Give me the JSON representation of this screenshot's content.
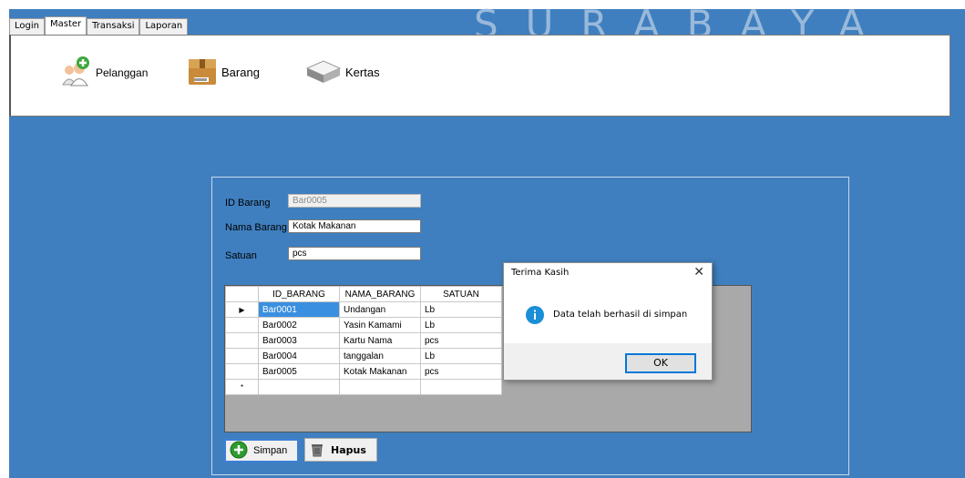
{
  "watermark": "SURABAYA",
  "tabs": [
    {
      "label": "Login"
    },
    {
      "label": "Master"
    },
    {
      "label": "Transaksi"
    },
    {
      "label": "Laporan"
    }
  ],
  "active_tab": "Master",
  "ribbon": {
    "pelanggan": "Pelanggan",
    "barang": "Barang",
    "kertas": "Kertas"
  },
  "form": {
    "id_label": "ID Barang",
    "id_value": "Bar0005",
    "nama_label": "Nama Barang",
    "nama_value": "Kotak Makanan",
    "satuan_label": "Satuan",
    "satuan_value": "pcs"
  },
  "grid": {
    "columns": [
      "ID_BARANG",
      "NAMA_BARANG",
      "SATUAN"
    ],
    "rows": [
      [
        "Bar0001",
        "Undangan",
        "Lb"
      ],
      [
        "Bar0002",
        "Yasin Kamami",
        "Lb"
      ],
      [
        "Bar0003",
        "Kartu Nama",
        "pcs"
      ],
      [
        "Bar0004",
        "tanggalan",
        "Lb"
      ],
      [
        "Bar0005",
        "Kotak Makanan",
        "pcs"
      ]
    ],
    "current_row_marker": "▶",
    "new_row_marker": "*"
  },
  "buttons": {
    "simpan": "Simpan",
    "hapus": "Hapus"
  },
  "dialog": {
    "title": "Terima Kasih",
    "close": "✕",
    "message": "Data telah berhasil di simpan",
    "ok": "OK"
  },
  "colors": {
    "workspace": "#3f7fbf",
    "selection": "#3b8fe0",
    "info_icon": "#1a8fd8"
  }
}
